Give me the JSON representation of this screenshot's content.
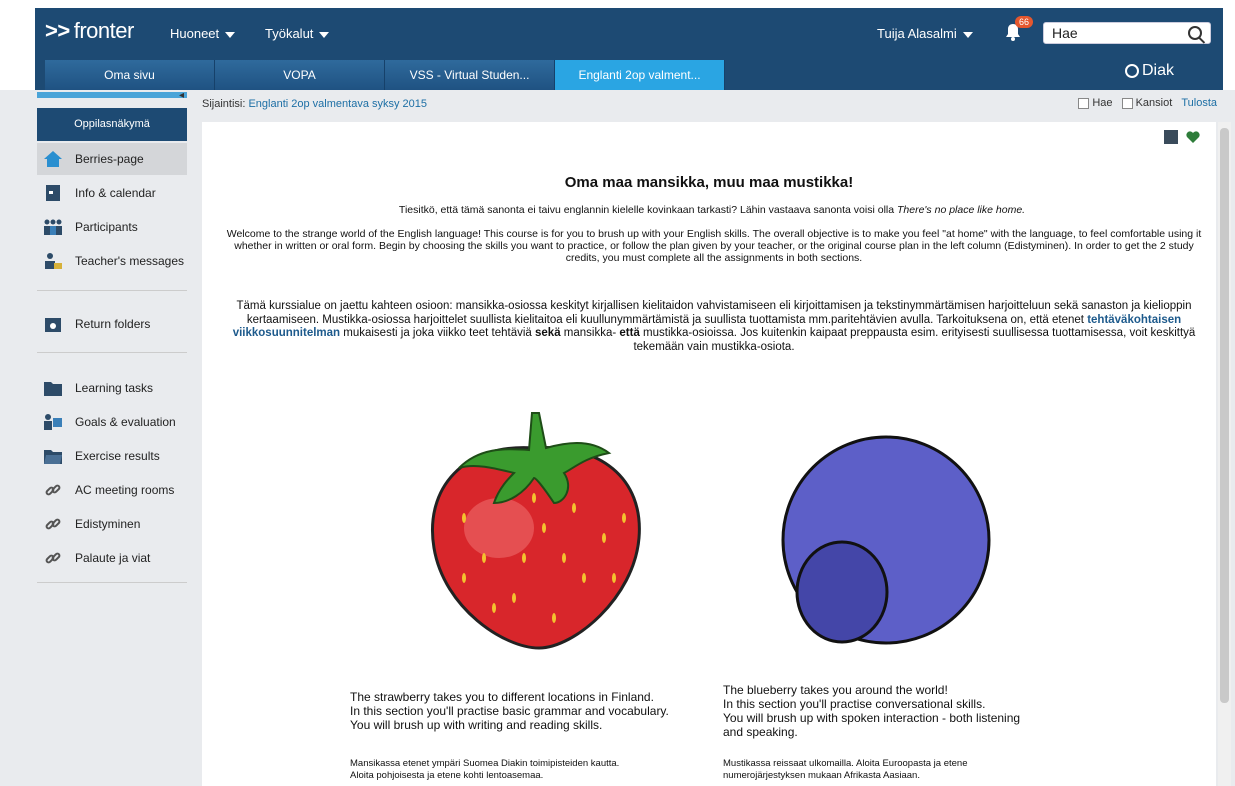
{
  "header": {
    "logo": "fronter",
    "logo_prefix": ">>",
    "menu_rooms": "Huoneet",
    "menu_tools": "Työkalut",
    "user": "Tuija Alasalmi",
    "notification_count": "66",
    "search_placeholder": "Hae",
    "brand": "Diak"
  },
  "tabs": [
    {
      "label": "Oma sivu"
    },
    {
      "label": "VOPA"
    },
    {
      "label": "VSS - Virtual Studen..."
    },
    {
      "label": "Englanti 2op valment..."
    }
  ],
  "sidebar": {
    "student_view": "Oppilasnäkymä",
    "items": [
      {
        "label": "Berries-page",
        "icon": "home-icon"
      },
      {
        "label": "Info & calendar",
        "icon": "calendar-icon"
      },
      {
        "label": "Participants",
        "icon": "people-icon"
      },
      {
        "label": "Teacher's messages",
        "icon": "messages-icon"
      },
      {
        "label": "Return folders",
        "icon": "return-folder-icon"
      },
      {
        "label": "Learning tasks",
        "icon": "folder-icon"
      },
      {
        "label": "Goals & evaluation",
        "icon": "goals-icon"
      },
      {
        "label": "Exercise results",
        "icon": "results-folder-icon"
      },
      {
        "label": "AC meeting rooms",
        "icon": "link-icon"
      },
      {
        "label": "Edistyminen",
        "icon": "link-icon"
      },
      {
        "label": "Palaute ja viat",
        "icon": "link-icon"
      }
    ]
  },
  "breadcrumb": {
    "label": "Sijaintisi:",
    "location": "Englanti 2op valmentava syksy 2015"
  },
  "toolbar": {
    "search": "Hae",
    "folders": "Kansiot",
    "print": "Tulosta"
  },
  "content": {
    "title": "Oma maa mansikka, muu maa mustikka!",
    "intro_fi_a": "Tiesitkö, että tämä sanonta ei taivu englannin kielelle kovinkaan tarkasti? Lähin vastaava sanonta voisi olla ",
    "intro_fi_em": "There's no place like home.",
    "intro_en": "Welcome to the strange world of the English language! This course is for you to brush up with your English skills. The overall objective is to make you feel \"at home\" with the language, to feel comfortable using it whether in written or oral form. Begin by choosing the skills you want to practice, or follow the plan given by your teacher, or the original course plan in the left column (Edistyminen). In order to get the 2 study credits, you must complete all the assignments in both sections.",
    "fi_a": "Tämä kurssialue on jaettu kahteen osioon: mansikka-osiossa keskityt kirjallisen kielitaidon vahvistamiseen eli kirjoittamisen ja tekstinymmärtämisen harjoitteluun sekä sanaston ja kielioppin kertaamiseen. Mustikka-osiossa harjoittelet suullista kielitaitoa eli kuullunymmärtämistä ja suullista tuottamista mm.paritehtävien avulla. Tarkoituksena on, että etenet ",
    "fi_link": "tehtäväkohtaisen viikkosuunnitelman",
    "fi_b": " mukaisesti ja joka viikko teet tehtäviä ",
    "fi_bold1": "sekä",
    "fi_c": " mansikka- ",
    "fi_bold2": "että",
    "fi_d": " mustikka-osioissa. Jos kuitenkin kaipaat preppausta esim. erityisesti suullisessa tuottamisessa, voit keskittyä tekemään vain mustikka-osiota.",
    "strawberry_1": "The strawberry takes you to different locations in Finland.",
    "strawberry_2": "In this section you'll practise basic grammar and vocabulary.",
    "strawberry_3": "You will brush up with writing and reading skills.",
    "strawberry_fi_1": "Mansikassa etenet ympäri Suomea Diakin toimipisteiden kautta.",
    "strawberry_fi_2": "Aloita pohjoisesta ja etene kohti lentoasemaa.",
    "blueberry_1": "The blueberry takes you around the world!",
    "blueberry_2": "In this section you'll practise conversational skills.",
    "blueberry_3": "You will brush up with spoken interaction - both listening",
    "blueberry_4": "and speaking.",
    "blueberry_fi_1": "Mustikassa reissaat ulkomailla. Aloita Euroopasta ja etene",
    "blueberry_fi_2": "numerojärjestyksen mukaan Afrikasta Aasiaan."
  },
  "colors": {
    "header_bg": "#1d4a73",
    "active_tab": "#2aa5e3",
    "link": "#1d6fa5",
    "strawberry": "#d8262b",
    "blueberry": "#5d5fc8"
  }
}
